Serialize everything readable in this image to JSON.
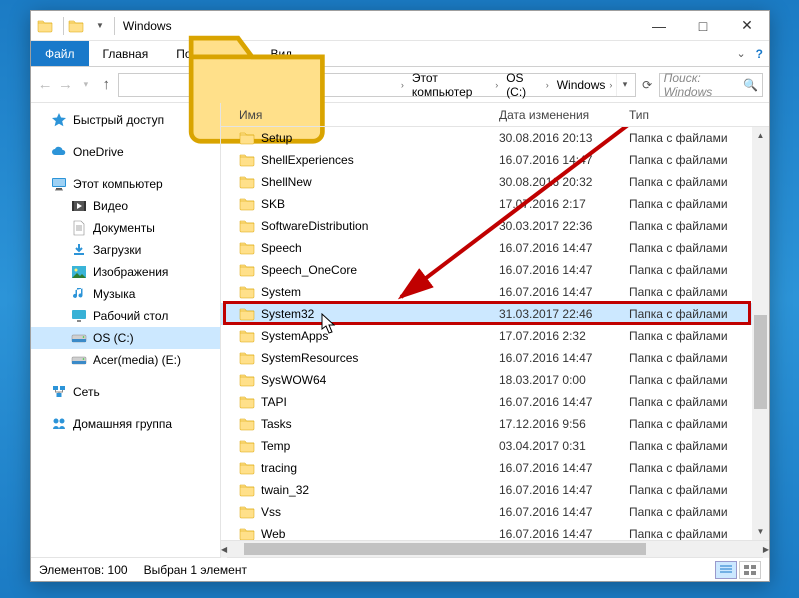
{
  "window": {
    "title": "Windows"
  },
  "ribbon": {
    "file": "Файл",
    "tabs": [
      "Главная",
      "Поделиться",
      "Вид"
    ]
  },
  "breadcrumb": [
    "Этот компьютер",
    "OS (C:)",
    "Windows"
  ],
  "search": {
    "placeholder": "Поиск: Windows"
  },
  "columns": {
    "name": "Имя",
    "date": "Дата изменения",
    "type": "Тип"
  },
  "nav": {
    "quick": {
      "label": "Быстрый доступ"
    },
    "onedrive": {
      "label": "OneDrive"
    },
    "thispc": {
      "label": "Этот компьютер"
    },
    "children": [
      {
        "key": "video",
        "label": "Видео"
      },
      {
        "key": "documents",
        "label": "Документы"
      },
      {
        "key": "downloads",
        "label": "Загрузки"
      },
      {
        "key": "pictures",
        "label": "Изображения"
      },
      {
        "key": "music",
        "label": "Музыка"
      },
      {
        "key": "desktop",
        "label": "Рабочий стол"
      },
      {
        "key": "osc",
        "label": "OS (C:)",
        "selected": true
      },
      {
        "key": "acer",
        "label": "Acer(media) (E:)"
      }
    ],
    "network": {
      "label": "Сеть"
    },
    "homegroup": {
      "label": "Домашняя группа"
    }
  },
  "files": [
    {
      "name": "Setup",
      "date": "30.08.2016 20:13",
      "type": "Папка с файлами"
    },
    {
      "name": "ShellExperiences",
      "date": "16.07.2016 14:47",
      "type": "Папка с файлами"
    },
    {
      "name": "ShellNew",
      "date": "30.08.2016 20:32",
      "type": "Папка с файлами"
    },
    {
      "name": "SKB",
      "date": "17.07.2016 2:17",
      "type": "Папка с файлами"
    },
    {
      "name": "SoftwareDistribution",
      "date": "30.03.2017 22:36",
      "type": "Папка с файлами"
    },
    {
      "name": "Speech",
      "date": "16.07.2016 14:47",
      "type": "Папка с файлами"
    },
    {
      "name": "Speech_OneCore",
      "date": "16.07.2016 14:47",
      "type": "Папка с файлами"
    },
    {
      "name": "System",
      "date": "16.07.2016 14:47",
      "type": "Папка с файлами"
    },
    {
      "name": "System32",
      "date": "31.03.2017 22:46",
      "type": "Папка с файлами",
      "selected": true
    },
    {
      "name": "SystemApps",
      "date": "17.07.2016 2:32",
      "type": "Папка с файлами"
    },
    {
      "name": "SystemResources",
      "date": "16.07.2016 14:47",
      "type": "Папка с файлами"
    },
    {
      "name": "SysWOW64",
      "date": "18.03.2017 0:00",
      "type": "Папка с файлами"
    },
    {
      "name": "TAPI",
      "date": "16.07.2016 14:47",
      "type": "Папка с файлами"
    },
    {
      "name": "Tasks",
      "date": "17.12.2016 9:56",
      "type": "Папка с файлами"
    },
    {
      "name": "Temp",
      "date": "03.04.2017 0:31",
      "type": "Папка с файлами"
    },
    {
      "name": "tracing",
      "date": "16.07.2016 14:47",
      "type": "Папка с файлами"
    },
    {
      "name": "twain_32",
      "date": "16.07.2016 14:47",
      "type": "Папка с файлами"
    },
    {
      "name": "Vss",
      "date": "16.07.2016 14:47",
      "type": "Папка с файлами"
    },
    {
      "name": "Web",
      "date": "16.07.2016 14:47",
      "type": "Папка с файлами"
    }
  ],
  "status": {
    "count": "Элементов: 100",
    "selection": "Выбран 1 элемент"
  }
}
